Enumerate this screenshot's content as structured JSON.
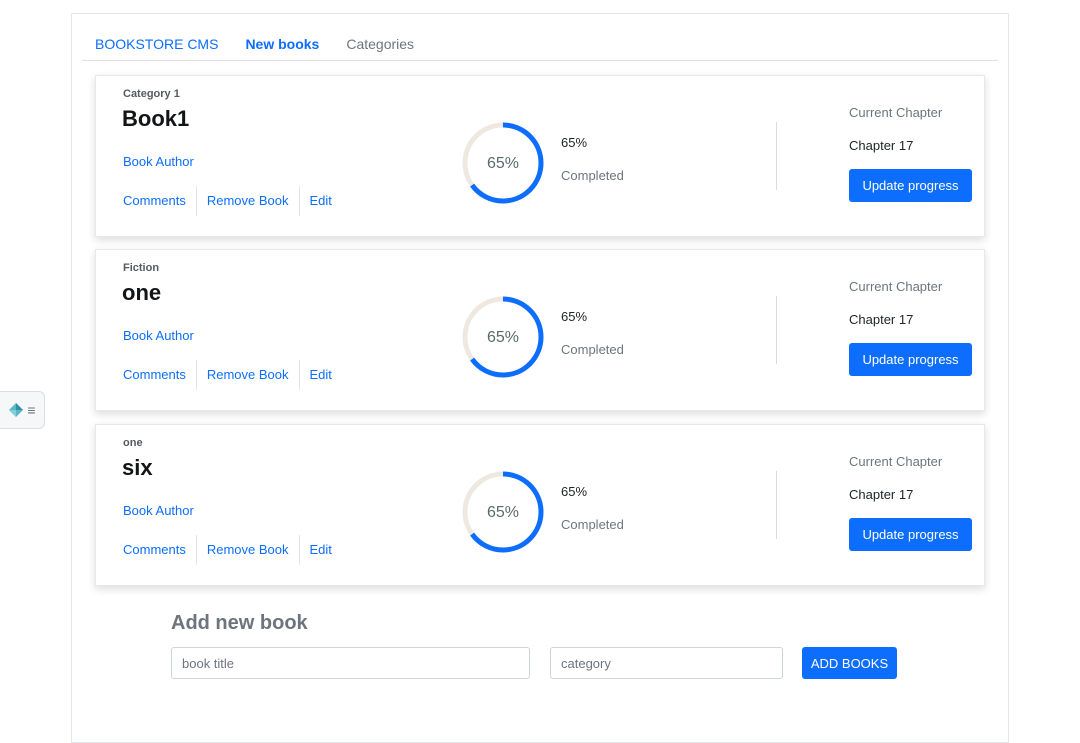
{
  "nav": {
    "brand": "BOOKSTORE CMS",
    "links": [
      {
        "label": "New books",
        "active": true
      },
      {
        "label": "Categories",
        "active": false
      }
    ]
  },
  "books": [
    {
      "category": "Category 1",
      "title": "Book1",
      "author": "Book Author",
      "progress_percent": 65,
      "progress_label": "65%",
      "completed_label": "Completed",
      "current_chapter_label": "Current Chapter",
      "current_chapter": "Chapter 17",
      "update_button": "Update progress",
      "actions": [
        "Comments",
        "Remove Book",
        "Edit"
      ]
    },
    {
      "category": "Fiction",
      "title": "one",
      "author": "Book Author",
      "progress_percent": 65,
      "progress_label": "65%",
      "completed_label": "Completed",
      "current_chapter_label": "Current Chapter",
      "current_chapter": "Chapter 17",
      "update_button": "Update progress",
      "actions": [
        "Comments",
        "Remove Book",
        "Edit"
      ]
    },
    {
      "category": "one",
      "title": "six",
      "author": "Book Author",
      "progress_percent": 65,
      "progress_label": "65%",
      "completed_label": "Completed",
      "current_chapter_label": "Current Chapter",
      "current_chapter": "Chapter 17",
      "update_button": "Update progress",
      "actions": [
        "Comments",
        "Remove Book",
        "Edit"
      ]
    }
  ],
  "add_book": {
    "heading": "Add new book",
    "title_placeholder": "book title",
    "category_placeholder": "category",
    "submit_label": "ADD BOOKS"
  },
  "colors": {
    "accent": "#0d6efd",
    "progress_track": "#efe8e1",
    "muted_text": "#6c757d"
  },
  "widget": {
    "icons": [
      "diamond-icon",
      "menu-lines-icon"
    ]
  }
}
